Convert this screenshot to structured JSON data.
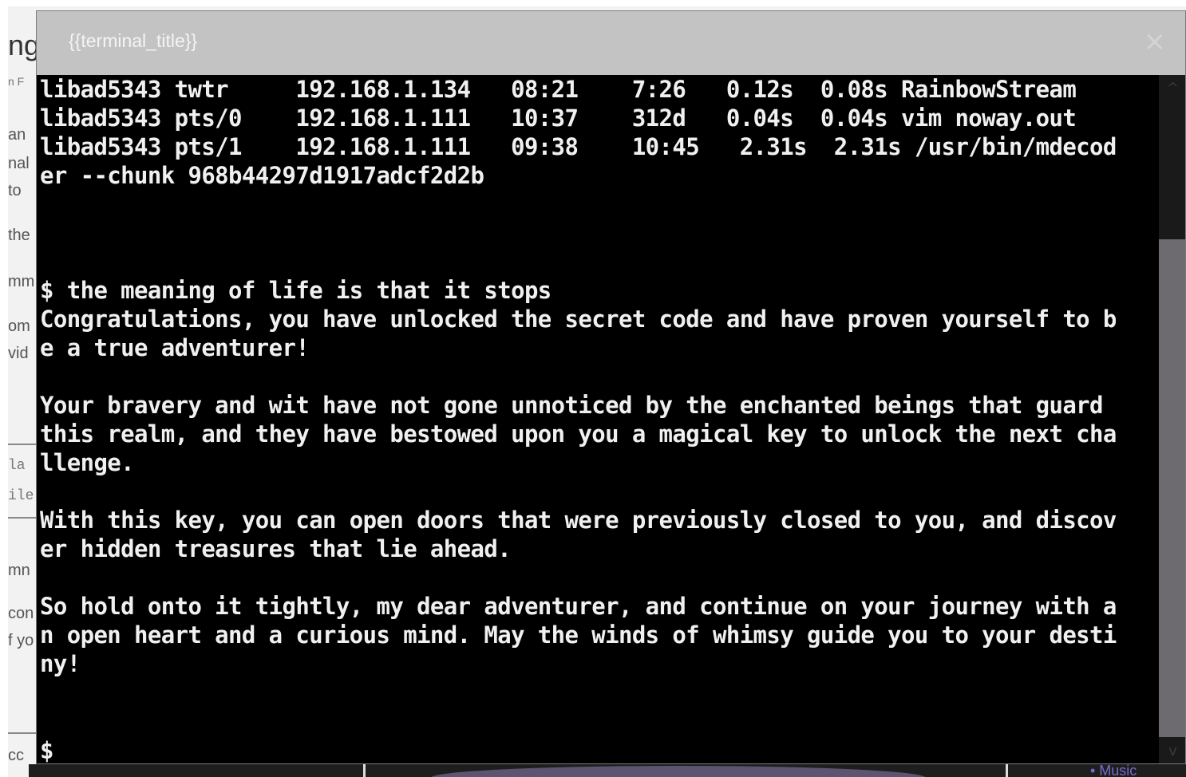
{
  "background_page": {
    "fragments": [
      "ng",
      "n F",
      "an",
      "nal",
      "to",
      "the",
      "mm",
      "om",
      "vid",
      "la",
      "ile",
      "mn",
      "con",
      "f yo",
      "cc"
    ],
    "music_label": "• Music"
  },
  "terminal": {
    "title": "{{terminal_title}}",
    "close_symbol": "×",
    "lines": [
      "libad5343 twtr     192.168.1.134   08:21    7:26   0.12s  0.08s RainbowStream",
      "libad5343 pts/0    192.168.1.111   10:37    312d   0.04s  0.04s vim noway.out",
      "libad5343 pts/1    192.168.1.111   09:38    10:45   2.31s  2.31s /usr/bin/mdecod",
      "er --chunk 968b44297d1917adcf2d2b",
      "",
      "",
      "",
      "$ the meaning of life is that it stops",
      "Congratulations, you have unlocked the secret code and have proven yourself to b",
      "e a true adventurer!",
      "",
      "Your bravery and wit have not gone unnoticed by the enchanted beings that guard",
      "this realm, and they have bestowed upon you a magical key to unlock the next cha",
      "llenge.",
      "",
      "With this key, you can open doors that were previously closed to you, and discov",
      "er hidden treasures that lie ahead.",
      "",
      "So hold onto it tightly, my dear adventurer, and continue on your journey with a",
      "n open heart and a curious mind. May the winds of whimsy guide you to your desti",
      "ny!"
    ],
    "prompt": "$",
    "scroll_up_symbol": "^",
    "scroll_down_symbol": "v"
  }
}
